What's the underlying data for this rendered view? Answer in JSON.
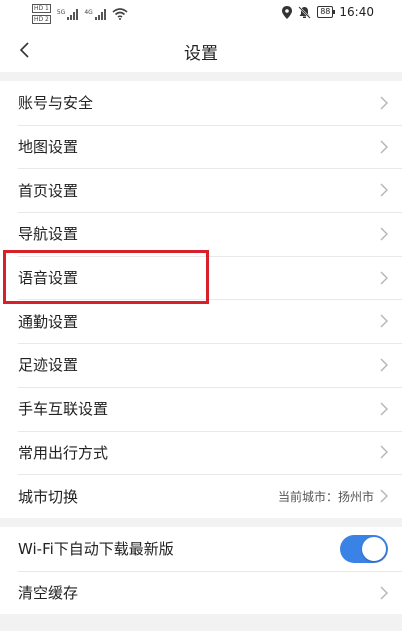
{
  "status_bar": {
    "sim1": "HD 1",
    "sim2": "HD 2",
    "net1": "5G",
    "net2": "4G",
    "battery": "88",
    "time": "16:40"
  },
  "header": {
    "title": "设置",
    "back_icon": "chevron-left-icon"
  },
  "menu_groups": [
    [
      {
        "label": "账号与安全"
      },
      {
        "label": "地图设置"
      },
      {
        "label": "首页设置"
      },
      {
        "label": "导航设置"
      },
      {
        "label": "语音设置"
      },
      {
        "label": "通勤设置"
      },
      {
        "label": "足迹设置"
      },
      {
        "label": "手车互联设置"
      },
      {
        "label": "常用出行方式"
      },
      {
        "label": "城市切换",
        "value": "当前城市：扬州市"
      }
    ],
    [
      {
        "label": "Wi-Fi下自动下载最新版",
        "toggle": true
      },
      {
        "label": "清空缓存"
      }
    ]
  ],
  "colors": {
    "toggle_on": "#3b82e6",
    "highlight": "#d7202a",
    "chevron": "#b5b5b5"
  }
}
